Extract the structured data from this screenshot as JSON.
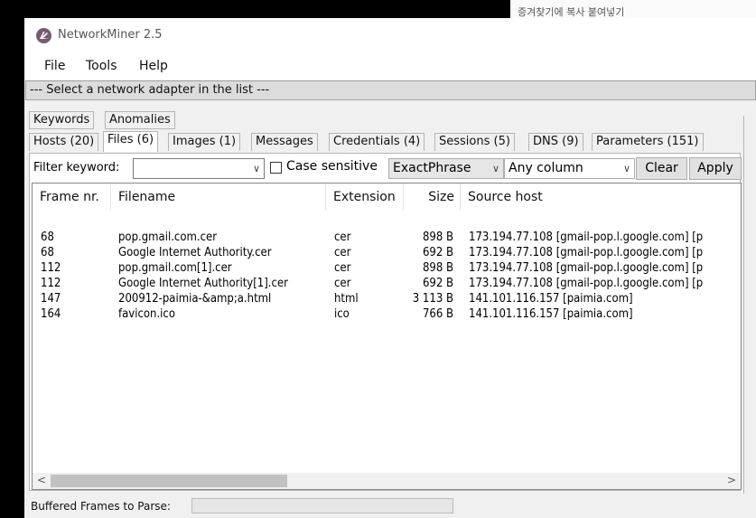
{
  "background_app": {
    "text": "증겨찾기에  복사  붙여넣기"
  },
  "window": {
    "title": "NetworkMiner 2.5",
    "menu": [
      "File",
      "Tools",
      "Help"
    ],
    "adapter_select": "--- Select a network adapter in the list ---"
  },
  "tabs_row1": [
    "Keywords",
    "Anomalies"
  ],
  "tabs_row2": [
    "Hosts (20)",
    "Files (6)",
    "Images (1)",
    "Messages",
    "Credentials (4)",
    "Sessions (5)",
    "DNS (9)",
    "Parameters (151)"
  ],
  "active_tab": "Files (6)",
  "filter": {
    "label": "Filter keyword:",
    "keyword_value": "",
    "case_sensitive_label": "Case sensitive",
    "case_sensitive_checked": false,
    "match_mode": "ExactPhrase",
    "column": "Any column",
    "clear_label": "Clear",
    "apply_label": "Apply"
  },
  "table": {
    "columns": [
      "Frame nr.",
      "Filename",
      "Extension",
      "Size",
      "Source host"
    ],
    "rows": [
      [
        "68",
        "pop.gmail.com.cer",
        "cer",
        "898 B",
        "173.194.77.108 [gmail-pop.l.google.com] [p"
      ],
      [
        "68",
        "Google Internet Authority.cer",
        "cer",
        "692 B",
        "173.194.77.108 [gmail-pop.l.google.com] [p"
      ],
      [
        "112",
        "pop.gmail.com[1].cer",
        "cer",
        "898 B",
        "173.194.77.108 [gmail-pop.l.google.com] [p"
      ],
      [
        "112",
        "Google Internet Authority[1].cer",
        "cer",
        "692 B",
        "173.194.77.108 [gmail-pop.l.google.com] [p"
      ],
      [
        "147",
        "200912-paimia-&amp;a.html",
        "html",
        "3 113 B",
        "141.101.116.157 [paimia.com]"
      ],
      [
        "164",
        "favicon.ico",
        "ico",
        "766 B",
        "141.101.116.157 [paimia.com]"
      ]
    ]
  },
  "status": {
    "label": "Buffered Frames to Parse:"
  },
  "icons": {
    "app": "networkminer-logo-icon",
    "dropdown": "chevron-down-icon",
    "scroll_left": "scroll-left-icon",
    "scroll_right": "scroll-right-icon"
  }
}
